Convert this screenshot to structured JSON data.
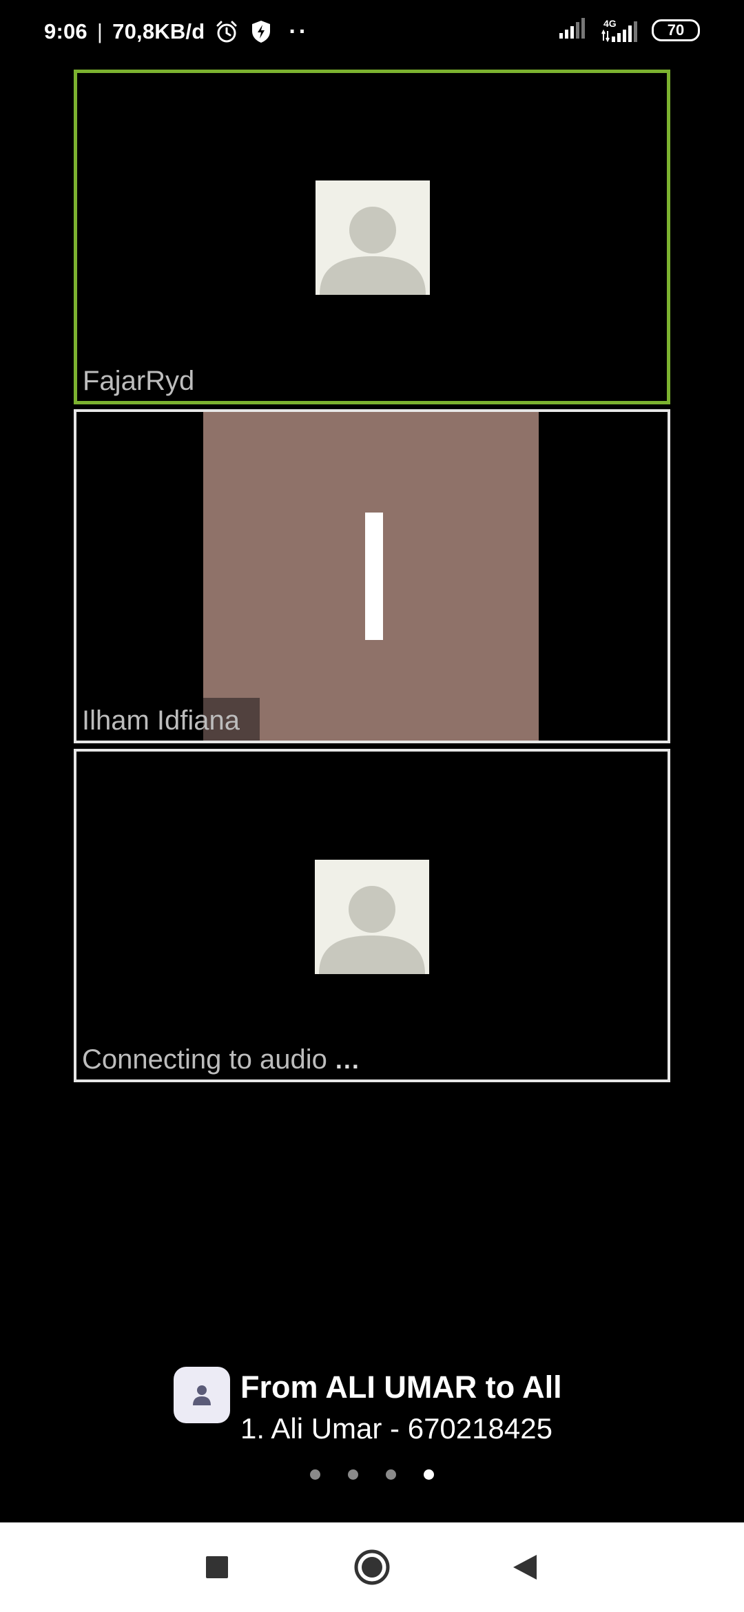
{
  "status_bar": {
    "time": "9:06",
    "separator": "|",
    "net_speed": "70,8KB/d",
    "overflow_dots": "··",
    "network_type": "4G",
    "battery_level": "70",
    "icons": [
      "alarm-icon",
      "shield-bolt-icon",
      "signal-icon",
      "signal-4g-icon",
      "battery-icon"
    ]
  },
  "tiles": [
    {
      "name": "FajarRyd",
      "active": true,
      "border_color": "#7cb230",
      "avatar": "default-avatar-icon"
    },
    {
      "name": "Ilham Idfiana",
      "active": false,
      "border_color": "#e6e6e6",
      "video_color": "#8f7269"
    },
    {
      "name": "Connecting to audio",
      "status_dots": "...",
      "active": false,
      "border_color": "#e6e6e6",
      "avatar": "default-avatar-icon"
    }
  ],
  "chat": {
    "title": "From ALI UMAR to All",
    "message": "1. Ali Umar - 670218425",
    "avatar_icon": "user-icon"
  },
  "pagination": {
    "count": 4,
    "active_index": 3
  },
  "nav": {
    "icons": [
      "recent-apps-icon",
      "home-icon",
      "back-icon"
    ]
  }
}
